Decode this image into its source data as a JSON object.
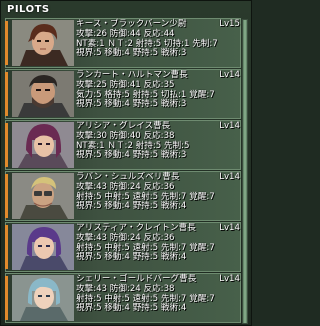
{
  "panel": {
    "title": "PILOTS"
  },
  "pilots": [
    {
      "name": "キース・ブラックバーン少尉",
      "level": "Lv15",
      "row2": "攻撃:26 防御:44 反応:44",
      "row3": "NT素:1 ＮＴ:2 射持:5 切持:1 先制:7",
      "row4": "視界:5 移動:4 野持:5 戦術:3"
    },
    {
      "name": "ランカート・ハルトマン曹長",
      "level": "Lv14",
      "row2": "攻撃:25 防御:41 反応:35",
      "row3": "気力:5 格持:5 射持:5 切払:1 覚醒:7",
      "row4": "視界:5 移動:4 野持:5 戦術:3"
    },
    {
      "name": "アリシア・グレイス曹長",
      "level": "Lv14",
      "row2": "攻撃:30 防御:40 反応:38",
      "row3": "NT素:1 ＮＴ:2 射持:5 先制:5",
      "row4": "視界:5 移動:4 野持:5 戦術:3"
    },
    {
      "name": "ラバン・シュルズベリ曹長",
      "level": "Lv14",
      "row2": "攻撃:43 防御:24 反応:36",
      "row3": "射持:5 中射:5 遠射:5 先制:7 覚醒:7",
      "row4": "視界:5 移動:4 野持:5 戦術:4"
    },
    {
      "name": "アリスティア・クレイトン曹長",
      "level": "Lv14",
      "row2": "攻撃:43 防御:24 反応:36",
      "row3": "射持:5 中射:5 遠射:5 先制:7 覚醒:7",
      "row4": "視界:5 移動:4 野持:5 戦術:4"
    },
    {
      "name": "シェリー・ゴールドバーグ曹長",
      "level": "Lv14",
      "row2": "攻撃:43 防御:24 反応:38",
      "row3": "射持:5 中射:5 遠射:5 先制:7 覚醒:7",
      "row4": "視界:5 移動:4 野持:5 戦術:4"
    }
  ]
}
